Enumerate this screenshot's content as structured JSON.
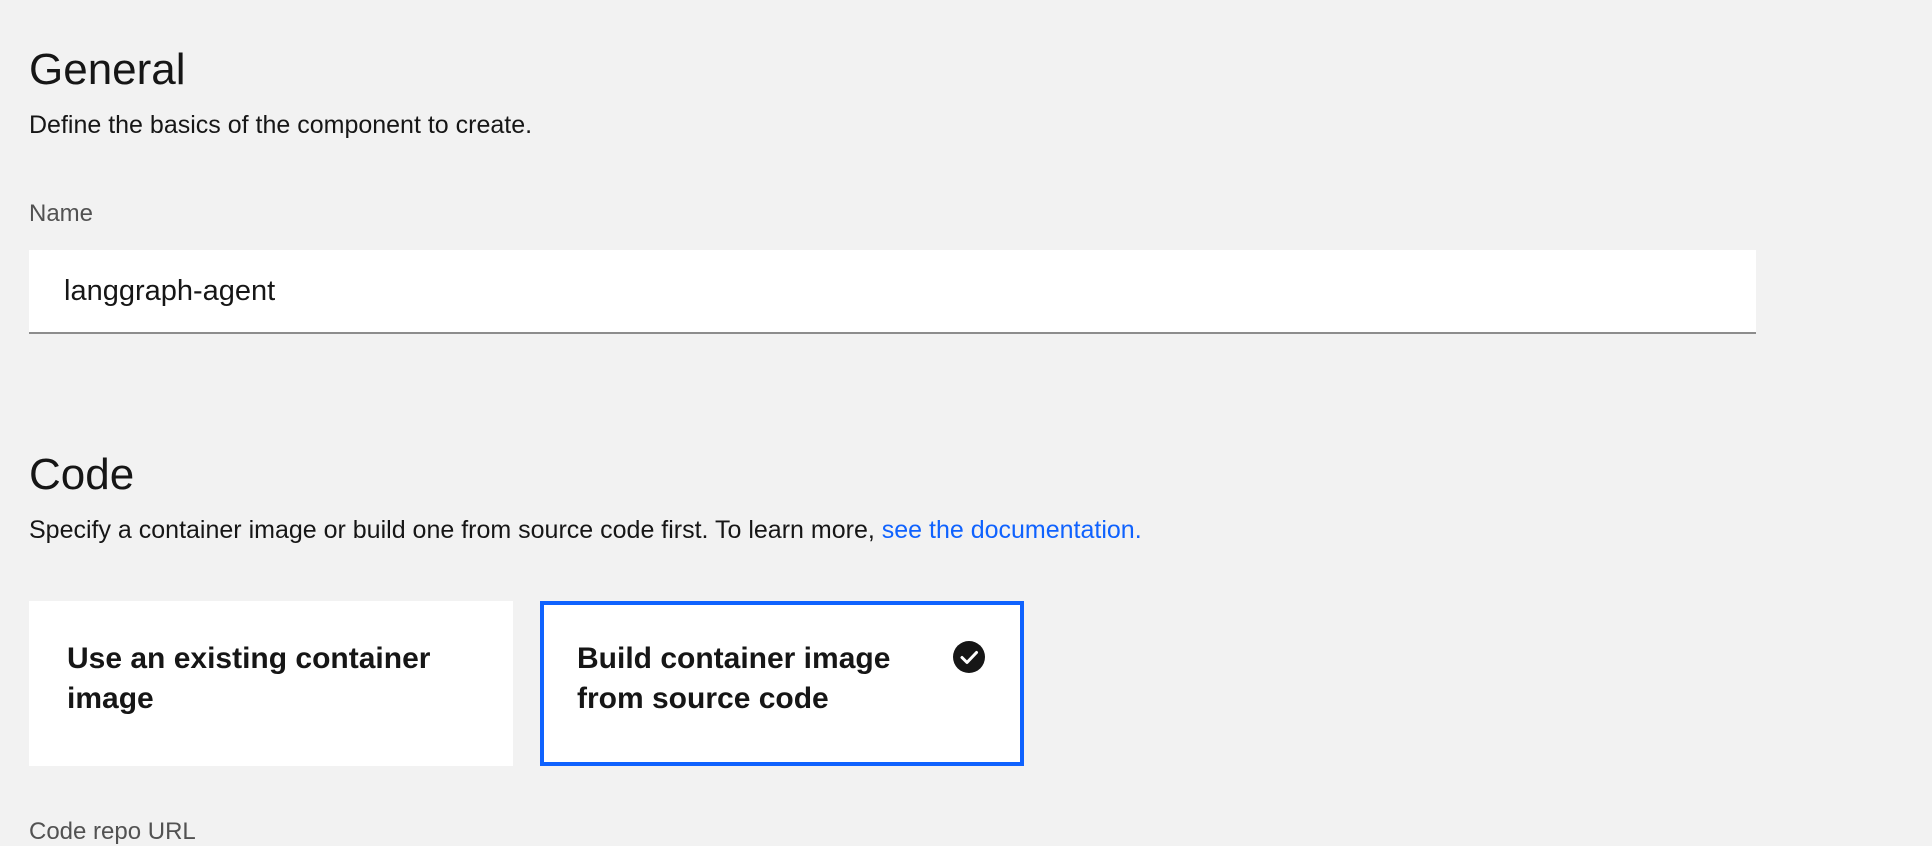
{
  "general": {
    "title": "General",
    "description": "Define the basics of the component to create."
  },
  "name_field": {
    "label": "Name",
    "value": "langgraph-agent"
  },
  "code": {
    "title": "Code",
    "description": "Specify a container image or build one from source code first. To learn more,",
    "link_text": "see the documentation."
  },
  "tiles": [
    {
      "label": "Use an existing container image",
      "selected": false
    },
    {
      "label": "Build container image from source code",
      "selected": true
    }
  ],
  "code_repo_field": {
    "label": "Code repo URL"
  },
  "colors": {
    "accent": "#0f62fe",
    "background": "#f2f2f2",
    "text": "#161616"
  },
  "icons": {
    "selected_tile": "checkmark-filled-icon"
  }
}
